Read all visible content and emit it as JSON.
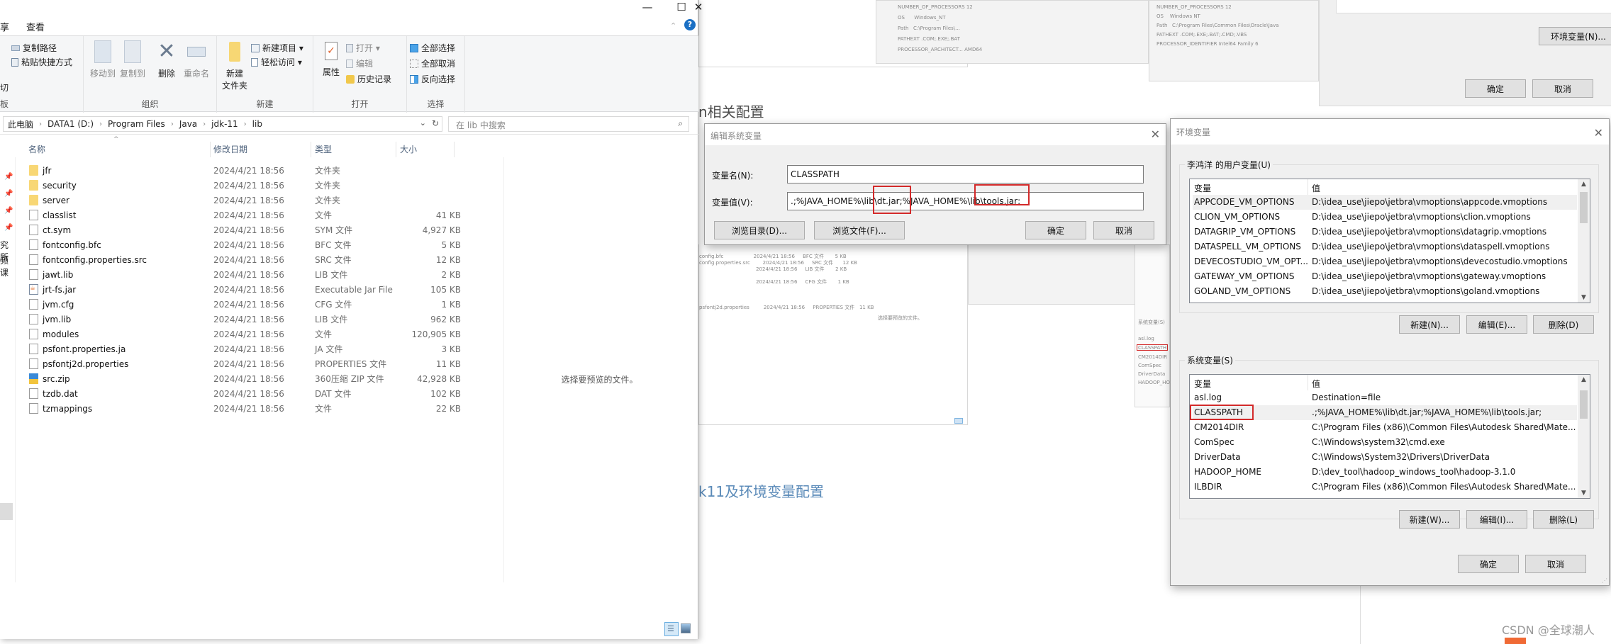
{
  "background": {
    "heading_partial_1": "n相关配置",
    "heading_partial_2": "k11及环境变量配置",
    "watermark": "CSDN @全球潮人",
    "sysprops_buttons": {
      "env_vars": "环境变量(N)...",
      "ok": "确定",
      "cancel": "取消"
    }
  },
  "explorer": {
    "window_controls": {
      "minimize": "—",
      "maximize": "☐",
      "close": "✕"
    },
    "tabs": [
      "享",
      "查看"
    ],
    "ribbon": {
      "clipboard": {
        "copy_path": "复制路径",
        "paste_shortcut": "粘贴快捷方式",
        "cut_partial": "切",
        "group_label_partial": "板"
      },
      "organize": {
        "move_to": "移动到",
        "copy_to": "复制到",
        "delete": "删除",
        "rename": "重命名",
        "group_label": "组织"
      },
      "new": {
        "new_folder_line1": "新建",
        "new_folder_line2": "文件夹",
        "new_item": "新建项目 ▾",
        "easy_access": "轻松访问 ▾",
        "group_label": "新建"
      },
      "open": {
        "properties": "属性",
        "open": "打开 ▾",
        "edit": "编辑",
        "history": "历史记录",
        "group_label": "打开"
      },
      "select": {
        "select_all": "全部选择",
        "select_none": "全部取消",
        "invert": "反向选择",
        "group_label": "选择"
      }
    },
    "address": {
      "crumbs": [
        "此电脑",
        "DATA1 (D:)",
        "Program Files",
        "Java",
        "jdk-11",
        "lib"
      ],
      "search_placeholder": "在 lib 中搜索"
    },
    "nav_partial": [
      "究所",
      "频课"
    ],
    "columns": {
      "name": "名称",
      "date": "修改日期",
      "type": "类型",
      "size": "大小"
    },
    "files": [
      {
        "icon": "folder",
        "name": "jfr",
        "date": "2024/4/21 18:56",
        "type": "文件夹",
        "size": ""
      },
      {
        "icon": "folder",
        "name": "security",
        "date": "2024/4/21 18:56",
        "type": "文件夹",
        "size": ""
      },
      {
        "icon": "folder",
        "name": "server",
        "date": "2024/4/21 18:56",
        "type": "文件夹",
        "size": ""
      },
      {
        "icon": "file",
        "name": "classlist",
        "date": "2024/4/21 18:56",
        "type": "文件",
        "size": "41 KB"
      },
      {
        "icon": "file",
        "name": "ct.sym",
        "date": "2024/4/21 18:56",
        "type": "SYM 文件",
        "size": "4,927 KB"
      },
      {
        "icon": "file",
        "name": "fontconfig.bfc",
        "date": "2024/4/21 18:56",
        "type": "BFC 文件",
        "size": "5 KB"
      },
      {
        "icon": "file",
        "name": "fontconfig.properties.src",
        "date": "2024/4/21 18:56",
        "type": "SRC 文件",
        "size": "12 KB"
      },
      {
        "icon": "file",
        "name": "jawt.lib",
        "date": "2024/4/21 18:56",
        "type": "LIB 文件",
        "size": "2 KB"
      },
      {
        "icon": "jar",
        "name": "jrt-fs.jar",
        "date": "2024/4/21 18:56",
        "type": "Executable Jar File",
        "size": "105 KB"
      },
      {
        "icon": "file",
        "name": "jvm.cfg",
        "date": "2024/4/21 18:56",
        "type": "CFG 文件",
        "size": "1 KB"
      },
      {
        "icon": "file",
        "name": "jvm.lib",
        "date": "2024/4/21 18:56",
        "type": "LIB 文件",
        "size": "962 KB"
      },
      {
        "icon": "file",
        "name": "modules",
        "date": "2024/4/21 18:56",
        "type": "文件",
        "size": "120,905 KB"
      },
      {
        "icon": "file",
        "name": "psfont.properties.ja",
        "date": "2024/4/21 18:56",
        "type": "JA 文件",
        "size": "3 KB"
      },
      {
        "icon": "file",
        "name": "psfontj2d.properties",
        "date": "2024/4/21 18:56",
        "type": "PROPERTIES 文件",
        "size": "11 KB"
      },
      {
        "icon": "zip",
        "name": "src.zip",
        "date": "2024/4/21 18:56",
        "type": "360压缩 ZIP 文件",
        "size": "42,928 KB"
      },
      {
        "icon": "file",
        "name": "tzdb.dat",
        "date": "2024/4/21 18:56",
        "type": "DAT 文件",
        "size": "102 KB"
      },
      {
        "icon": "file",
        "name": "tzmappings",
        "date": "2024/4/21 18:56",
        "type": "文件",
        "size": "22 KB"
      }
    ],
    "preview_text": "选择要预览的文件。"
  },
  "edit_dialog": {
    "title": "编辑系统变量",
    "name_label": "变量名(N):",
    "name_value": "CLASSPATH",
    "value_label": "变量值(V):",
    "value_value": ".;%JAVA_HOME%\\lib\\dt.jar;%JAVA_HOME%\\lib\\tools.jar;",
    "browse_dir": "浏览目录(D)...",
    "browse_file": "浏览文件(F)...",
    "ok": "确定",
    "cancel": "取消",
    "highlight_color": "#d32a2a"
  },
  "env_dialog": {
    "title": "环境变量",
    "user_group": "李鸿洋 的用户变量(U)",
    "system_group": "系统变量(S)",
    "col_var": "变量",
    "col_val": "值",
    "user_vars": [
      {
        "name": "APPCODE_VM_OPTIONS",
        "value": "D:\\idea_use\\jiepo\\jetbra\\vmoptions\\appcode.vmoptions"
      },
      {
        "name": "CLION_VM_OPTIONS",
        "value": "D:\\idea_use\\jiepo\\jetbra\\vmoptions\\clion.vmoptions"
      },
      {
        "name": "DATAGRIP_VM_OPTIONS",
        "value": "D:\\idea_use\\jiepo\\jetbra\\vmoptions\\datagrip.vmoptions"
      },
      {
        "name": "DATASPELL_VM_OPTIONS",
        "value": "D:\\idea_use\\jiepo\\jetbra\\vmoptions\\dataspell.vmoptions"
      },
      {
        "name": "DEVECOSTUDIO_VM_OPT...",
        "value": "D:\\idea_use\\jiepo\\jetbra\\vmoptions\\devecostudio.vmoptions"
      },
      {
        "name": "GATEWAY_VM_OPTIONS",
        "value": "D:\\idea_use\\jiepo\\jetbra\\vmoptions\\gateway.vmoptions"
      },
      {
        "name": "GOLAND_VM_OPTIONS",
        "value": "D:\\idea_use\\jiepo\\jetbra\\vmoptions\\goland.vmoptions"
      }
    ],
    "user_buttons": {
      "new": "新建(N)...",
      "edit": "编辑(E)...",
      "delete": "删除(D)"
    },
    "system_vars": [
      {
        "name": "asl.log",
        "value": "Destination=file"
      },
      {
        "name": "CLASSPATH",
        "value": ".;%JAVA_HOME%\\lib\\dt.jar;%JAVA_HOME%\\lib\\tools.jar;"
      },
      {
        "name": "CM2014DIR",
        "value": "C:\\Program Files (x86)\\Common Files\\Autodesk Shared\\Mate..."
      },
      {
        "name": "ComSpec",
        "value": "C:\\Windows\\system32\\cmd.exe"
      },
      {
        "name": "DriverData",
        "value": "C:\\Windows\\System32\\Drivers\\DriverData"
      },
      {
        "name": "HADOOP_HOME",
        "value": "D:\\dev_tool\\hadoop_windows_tool\\hadoop-3.1.0"
      },
      {
        "name": "ILBDIR",
        "value": "C:\\Program Files (x86)\\Common Files\\Autodesk Shared\\Mate..."
      }
    ],
    "system_buttons": {
      "new": "新建(W)...",
      "edit": "编辑(I)...",
      "delete": "删除(L)"
    },
    "ok": "确定",
    "cancel": "取消"
  }
}
